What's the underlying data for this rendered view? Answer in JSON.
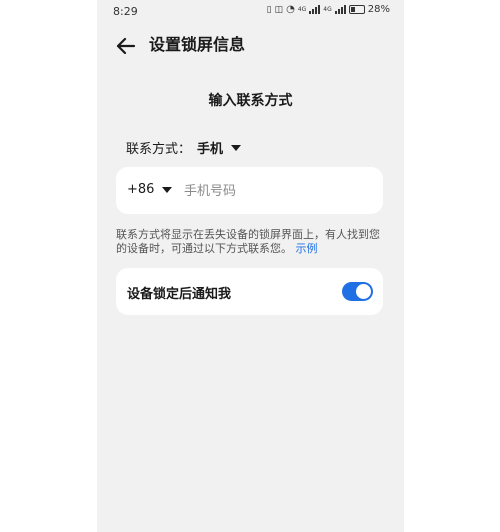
{
  "status_bar": {
    "time": "8:29",
    "battery": "28%",
    "network_1": "4G",
    "network_2": "4G"
  },
  "header": {
    "back_icon": "arrow-left-icon",
    "title": "设置锁屏信息"
  },
  "main": {
    "section_title": "输入联系方式",
    "contact_type_label": "联系方式：",
    "contact_type_value": "手机",
    "country_code": "+86",
    "phone_placeholder": "手机号码",
    "phone_value": "",
    "hint_text": "联系方式将显示在丢失设备的锁屏界面上，有人找到您的设备时，可通过以下方式联系您。",
    "hint_link": "示例",
    "notify_label": "设备锁定后通知我",
    "notify_enabled": true
  },
  "colors": {
    "accent": "#1f6fe5",
    "background": "#f1f1f1",
    "card": "#ffffff"
  }
}
